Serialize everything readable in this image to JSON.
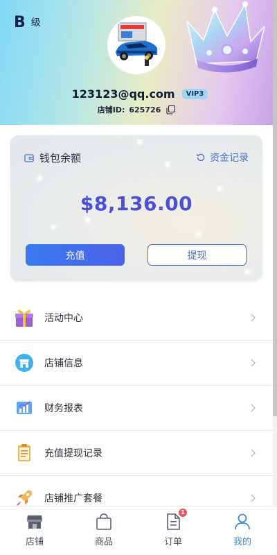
{
  "header": {
    "level_letter": "B",
    "level_text": "级",
    "email": "123123@qq.com",
    "vip_badge": "VIP3",
    "store_id_label": "店铺ID:",
    "store_id_value": "625726"
  },
  "wallet": {
    "title": "钱包余额",
    "records_label": "资金记录",
    "balance": "$8,136.00",
    "recharge_label": "充值",
    "withdraw_label": "提现"
  },
  "menu": {
    "items": [
      {
        "label": "活动中心",
        "icon": "gift-icon"
      },
      {
        "label": "店铺信息",
        "icon": "store-info-icon"
      },
      {
        "label": "财务报表",
        "icon": "finance-chart-icon"
      },
      {
        "label": "充值提现记录",
        "icon": "clipboard-icon"
      },
      {
        "label": "店铺推广套餐",
        "icon": "rocket-icon"
      }
    ]
  },
  "tabbar": {
    "tabs": [
      {
        "label": "店铺",
        "icon": "store-icon"
      },
      {
        "label": "商品",
        "icon": "shopping-bag-icon"
      },
      {
        "label": "订单",
        "icon": "document-icon",
        "badge": "1"
      },
      {
        "label": "我的",
        "icon": "user-icon",
        "active": true
      }
    ]
  },
  "colors": {
    "accent": "#3a8bd8",
    "balance": "#4b50d8",
    "link": "#4a6fc5",
    "badge": "#e85a5a"
  }
}
